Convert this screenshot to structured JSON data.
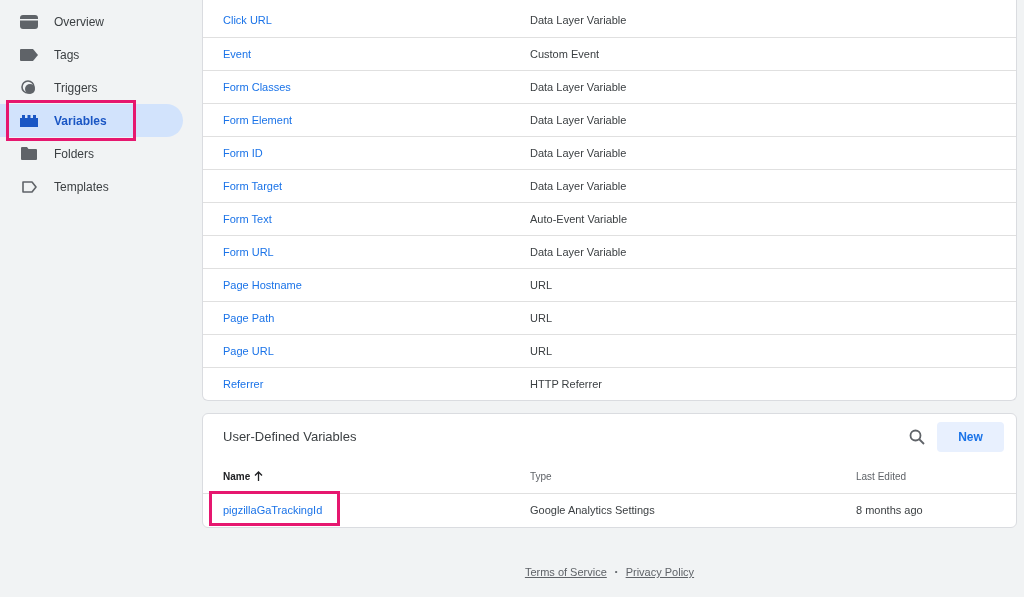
{
  "sidebar": {
    "items": [
      {
        "label": "Overview",
        "kind": "overview",
        "selected": false,
        "highlighted": false
      },
      {
        "label": "Tags",
        "kind": "tag",
        "selected": false,
        "highlighted": false
      },
      {
        "label": "Triggers",
        "kind": "trigger",
        "selected": false,
        "highlighted": false
      },
      {
        "label": "Variables",
        "kind": "variable",
        "selected": true,
        "highlighted": true
      },
      {
        "label": "Folders",
        "kind": "folder",
        "selected": false,
        "highlighted": false
      },
      {
        "label": "Templates",
        "kind": "template",
        "selected": false,
        "highlighted": false
      }
    ]
  },
  "built_in_variables": {
    "rows": [
      {
        "name": "Click URL",
        "type": "Data Layer Variable"
      },
      {
        "name": "Event",
        "type": "Custom Event"
      },
      {
        "name": "Form Classes",
        "type": "Data Layer Variable"
      },
      {
        "name": "Form Element",
        "type": "Data Layer Variable"
      },
      {
        "name": "Form ID",
        "type": "Data Layer Variable"
      },
      {
        "name": "Form Target",
        "type": "Data Layer Variable"
      },
      {
        "name": "Form Text",
        "type": "Auto-Event Variable"
      },
      {
        "name": "Form URL",
        "type": "Data Layer Variable"
      },
      {
        "name": "Page Hostname",
        "type": "URL"
      },
      {
        "name": "Page Path",
        "type": "URL"
      },
      {
        "name": "Page URL",
        "type": "URL"
      },
      {
        "name": "Referrer",
        "type": "HTTP Referrer"
      }
    ]
  },
  "user_defined_variables": {
    "title": "User-Defined Variables",
    "new_button": "New",
    "columns": [
      {
        "label": "Name",
        "sorted": true
      },
      {
        "label": "Type",
        "sorted": false
      },
      {
        "label": "Last Edited",
        "sorted": false
      }
    ],
    "rows": [
      {
        "name": "pigzillaGaTrackingId",
        "type": "Google Analytics Settings",
        "last_edited": "8 months ago",
        "highlighted": true
      }
    ]
  },
  "footer": {
    "links": [
      "Terms of Service",
      "Privacy Policy"
    ],
    "separator": "•"
  }
}
